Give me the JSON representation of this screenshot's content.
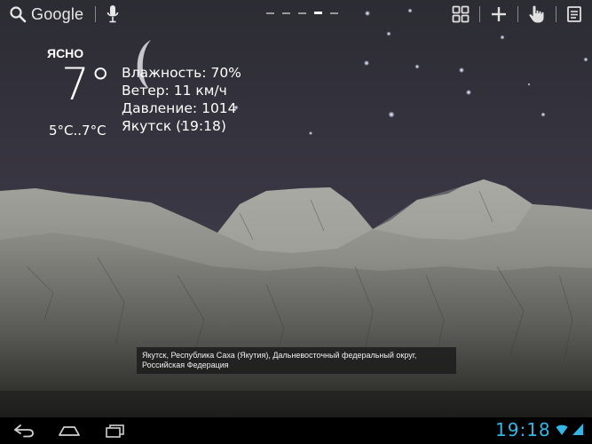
{
  "top_bar": {
    "search_label": "Google",
    "page_count": 5,
    "active_page": 4
  },
  "weather": {
    "condition": "ЯСНО",
    "temperature": "7°",
    "range": "5°C..7°C",
    "humidity": "Влажность: 70%",
    "wind": "Ветер: 11 км/ч",
    "pressure": "Давление: 1014",
    "location_time": "Якутск (19:18)"
  },
  "toast": {
    "line1": "Якутск, Республика Саха (Якутия), Дальневосточный федеральный округ,",
    "line2": "Российская Федерация"
  },
  "status_bar": {
    "time": "19:18"
  },
  "colors": {
    "sky_top": "#2e2e36",
    "sky_bottom": "#4a4556",
    "accent_clock": "#33b5e5"
  },
  "icons": [
    "search-icon",
    "mic-icon",
    "widgets-grid-icon",
    "add-icon",
    "hand-pointer-icon",
    "notes-icon",
    "back-icon",
    "home-icon",
    "recent-apps-icon",
    "wifi-icon",
    "signal-icon",
    "moon-icon"
  ]
}
